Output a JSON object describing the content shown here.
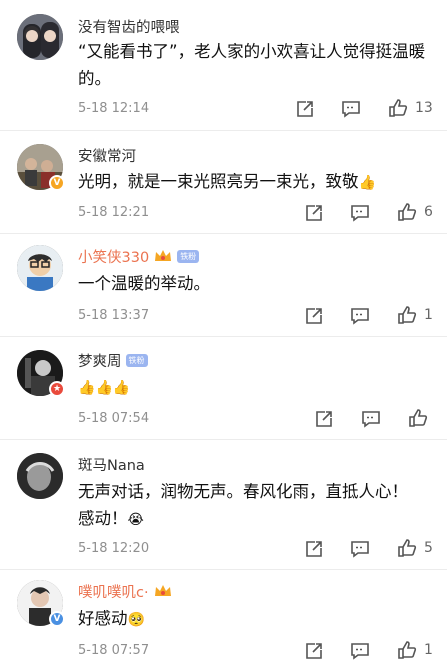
{
  "comments": [
    {
      "username": "没有智齿的喂喂",
      "text": "“又能看书了”，老人家的小欢喜让人觉得挺温暖的。",
      "time": "5-18 12:14",
      "likes": "13",
      "name_color": "#333333"
    },
    {
      "username": "安徽常河",
      "text": "光明，就是一束光照亮另一束光，致敬",
      "time": "5-18 12:21",
      "likes": "6",
      "name_color": "#333333"
    },
    {
      "username": "小笑侠330",
      "badge": "铁粉",
      "text": "一个温暖的举动。",
      "time": "5-18 13:37",
      "likes": "1",
      "name_color": "#eb7350"
    },
    {
      "username": "梦爽周",
      "badge": "铁粉",
      "text": "",
      "time": "5-18 07:54",
      "likes": "",
      "name_color": "#333333"
    },
    {
      "username": "斑马Nana",
      "text": "无声对话，润物无声。春风化雨，直抵人心！ 感动！",
      "time": "5-18 12:20",
      "likes": "5",
      "name_color": "#333333"
    },
    {
      "username": "噗叽噗叽c·",
      "text": "好感动",
      "time": "5-18 07:57",
      "likes": "1",
      "name_color": "#eb7350"
    }
  ],
  "icons": {
    "share": "share-icon",
    "comment": "comment-icon",
    "like": "thumbs-up-icon",
    "emoji_ok": "thumbs-up-emoji",
    "emoji_cry": "crying-emoji",
    "emoji_touched": "moved-emoji",
    "crown": "vip-crown-icon"
  }
}
